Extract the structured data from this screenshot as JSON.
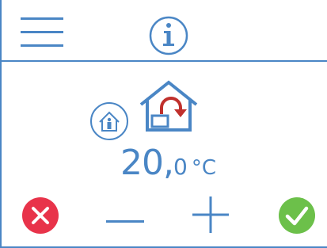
{
  "display": {
    "temperature_whole": "20,",
    "temperature_decimal": "0",
    "temperature_unit": "°C"
  },
  "icons": {
    "menu": "hamburger-menu-icon",
    "info": "info-icon",
    "occupancy": "occupant-in-house-icon",
    "mode": "house-return-arrow-icon",
    "cancel": "cancel-x-icon",
    "decrease": "minus-icon",
    "increase": "plus-icon",
    "confirm": "checkmark-icon"
  },
  "colors": {
    "primary_blue": "#4a86c5",
    "accent_red": "#c0302c",
    "cancel_red": "#e8334a",
    "confirm_green": "#6cc04a"
  }
}
